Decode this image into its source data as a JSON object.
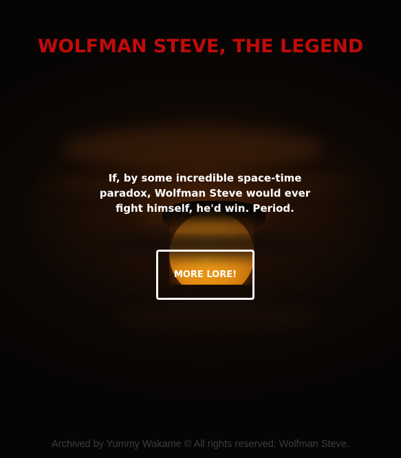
{
  "header": {
    "title": "WOLFMAN STEVE, THE LEGEND"
  },
  "main": {
    "quote": "If, by some incredible space-time paradox, Wolfman Steve would ever fight himself, he'd win. Period.",
    "more_button_label": "MORE LORE!"
  },
  "footer": {
    "text": "Archived by Yummy Wakame © All rights reserved: Wolfman Steve."
  },
  "colors": {
    "title": "#c00b0b",
    "background": "#070504",
    "moon": "#e08a12",
    "text": "#ffffff",
    "footer": "#3c3c3c"
  }
}
